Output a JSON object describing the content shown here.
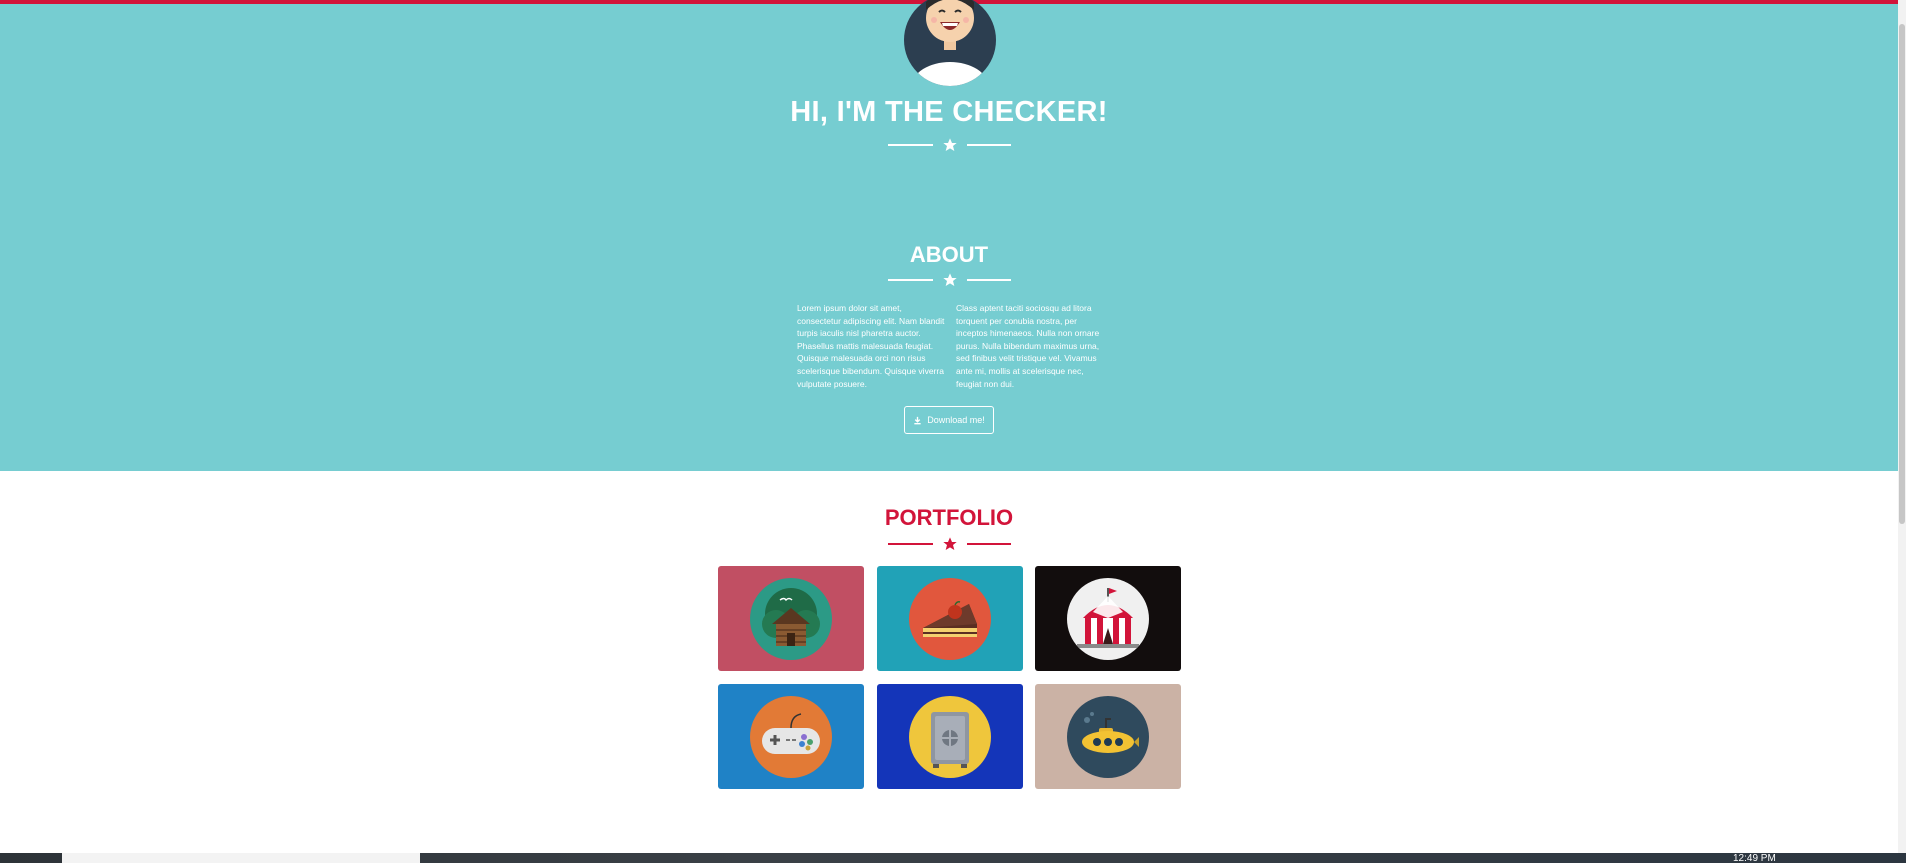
{
  "hero": {
    "title": "HI, I'M THE CHECKER!"
  },
  "about": {
    "title": "ABOUT",
    "column_left": "Lorem ipsum dolor sit amet, consectetur adipiscing elit. Nam blandit turpis iaculis nisl pharetra auctor. Phasellus mattis malesuada feugiat. Quisque malesuada orci non risus scelerisque bibendum. Quisque viverra vulputate posuere.",
    "column_right": "Class aptent taciti sociosqu ad litora torquent per conubia nostra, per inceptos himenaeos. Nulla non ornare purus. Nulla bibendum maximus urna, sed finibus velit tristique vel. Vivamus ante mi, mollis at scelerisque nec, feugiat non dui.",
    "download_label": "Download me!"
  },
  "portfolio": {
    "title": "PORTFOLIO",
    "items": [
      {
        "icon": "cabin-icon",
        "bg": "#c14f63",
        "circle": "#2c9a86"
      },
      {
        "icon": "cake-icon",
        "bg": "#21a2b7",
        "circle": "#e1573d"
      },
      {
        "icon": "circus-tent-icon",
        "bg": "#120d0d",
        "circle": "#f0f0f0"
      },
      {
        "icon": "game-controller-icon",
        "bg": "#1f82c6",
        "circle": "#e27a36"
      },
      {
        "icon": "safe-icon",
        "bg": "#1435b9",
        "circle": "#efc63c"
      },
      {
        "icon": "submarine-icon",
        "bg": "#cbb2a5",
        "circle": "#2f4a5d"
      }
    ]
  },
  "taskbar": {
    "clock": "12:49 PM"
  },
  "colors": {
    "accent": "#d2143a",
    "hero_bg": "#76cdd1"
  }
}
